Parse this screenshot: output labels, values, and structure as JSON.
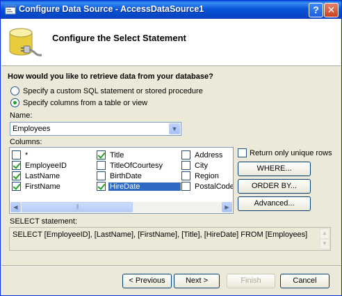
{
  "window": {
    "title": "Configure Data Source - AccessDataSource1",
    "help_glyph": "?",
    "close_glyph": "✕",
    "title_icon": "form-icon",
    "header_icon": "database-icon"
  },
  "header": {
    "title": "Configure the Select Statement"
  },
  "question": "How would you like to retrieve data from your database?",
  "options": [
    {
      "label": "Specify a custom SQL statement or stored procedure",
      "selected": false
    },
    {
      "label": "Specify columns from a table or view",
      "selected": true
    }
  ],
  "name_field": {
    "label": "Name:",
    "value": "Employees"
  },
  "columns": {
    "label": "Columns:",
    "items": [
      {
        "label": "*",
        "checked": false
      },
      {
        "label": "EmployeeID",
        "checked": true
      },
      {
        "label": "LastName",
        "checked": true
      },
      {
        "label": "FirstName",
        "checked": true
      },
      {
        "label": "Title",
        "checked": true
      },
      {
        "label": "TitleOfCourtesy",
        "checked": false
      },
      {
        "label": "BirthDate",
        "checked": false
      },
      {
        "label": "HireDate",
        "checked": true,
        "highlighted": true
      },
      {
        "label": "Address",
        "checked": false
      },
      {
        "label": "City",
        "checked": false
      },
      {
        "label": "Region",
        "checked": false
      },
      {
        "label": "PostalCode",
        "checked": false
      }
    ]
  },
  "unique_rows": {
    "label": "Return only unique rows",
    "checked": false
  },
  "side_buttons": {
    "where": "WHERE...",
    "order_by": "ORDER BY...",
    "advanced": "Advanced..."
  },
  "select_statement": {
    "label": "SELECT statement:",
    "text": "SELECT [EmployeeID], [LastName], [FirstName], [Title], [HireDate] FROM [Employees]"
  },
  "footer": {
    "previous": "< Previous",
    "next": "Next >",
    "finish": "Finish",
    "cancel": "Cancel"
  },
  "colors": {
    "title_bar": "#0a5fd8",
    "selection": "#316ac5",
    "check": "#21a121"
  }
}
